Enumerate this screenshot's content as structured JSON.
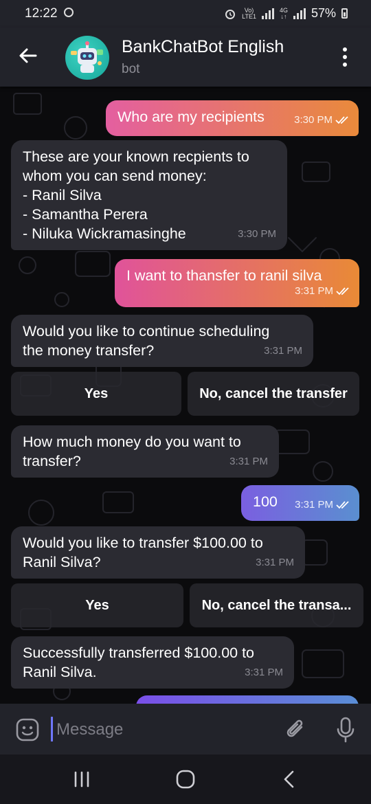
{
  "status_bar": {
    "time": "12:22",
    "network_top": "Vo)",
    "network_bottom": "LTE1",
    "net_type_top": "4G",
    "battery_percent": "57%"
  },
  "header": {
    "title": "BankChatBot English",
    "subtitle": "bot"
  },
  "messages": [
    {
      "id": "m1",
      "direction": "outgoing",
      "text": "Who are my recipients",
      "time": "3:30 PM"
    },
    {
      "id": "m2",
      "direction": "incoming",
      "lines": [
        "These are your known recpients to",
        "whom you can send money:",
        "- Ranil Silva",
        "- Samantha Perera",
        "- Niluka Wickramasinghe"
      ],
      "time": "3:30 PM"
    },
    {
      "id": "m3",
      "direction": "outgoing",
      "text": "I want to thansfer to ranil silva",
      "time": "3:31 PM"
    },
    {
      "id": "m4",
      "direction": "incoming",
      "lines": [
        "Would you like to continue scheduling",
        "the money transfer?"
      ],
      "time": "3:31 PM"
    },
    {
      "id": "m5",
      "direction": "incoming",
      "lines": [
        "How much money do you want to",
        "transfer?"
      ],
      "time": "3:31 PM"
    },
    {
      "id": "m6",
      "direction": "outgoing",
      "text": "100",
      "time": "3:31 PM"
    },
    {
      "id": "m7",
      "direction": "incoming",
      "lines": [
        "Would you like to transfer $100.00 to",
        "Ranil Silva?"
      ],
      "time": "3:31 PM"
    },
    {
      "id": "m8",
      "direction": "incoming",
      "lines": [
        "Successfully transferred $100.00 to",
        "Ranil Silva."
      ],
      "time": "3:31 PM"
    }
  ],
  "keyboards": {
    "k1": {
      "yes": "Yes",
      "no": "No, cancel the transfer"
    },
    "k2": {
      "yes": "Yes",
      "no": "No, cancel the transa..."
    }
  },
  "composer": {
    "placeholder": "Message"
  },
  "colors": {
    "grad_m1": [
      "#e45fa0",
      "#e98a3b"
    ],
    "grad_m3": [
      "#e0539a",
      "#e98a36"
    ],
    "grad_m6": [
      "#7a5fe0",
      "#5a8fd0"
    ],
    "grad_m9": [
      "#7a4fe8",
      "#5a8ed6"
    ],
    "incoming_bg": "#2b2b32",
    "header_bg": "#22232a"
  },
  "icons": [
    "back-arrow-icon",
    "kebab-menu-icon",
    "emoji-sticker-icon",
    "attach-paperclip-icon",
    "microphone-icon",
    "double-check-icon",
    "recents-icon",
    "home-icon",
    "nav-back-icon"
  ]
}
